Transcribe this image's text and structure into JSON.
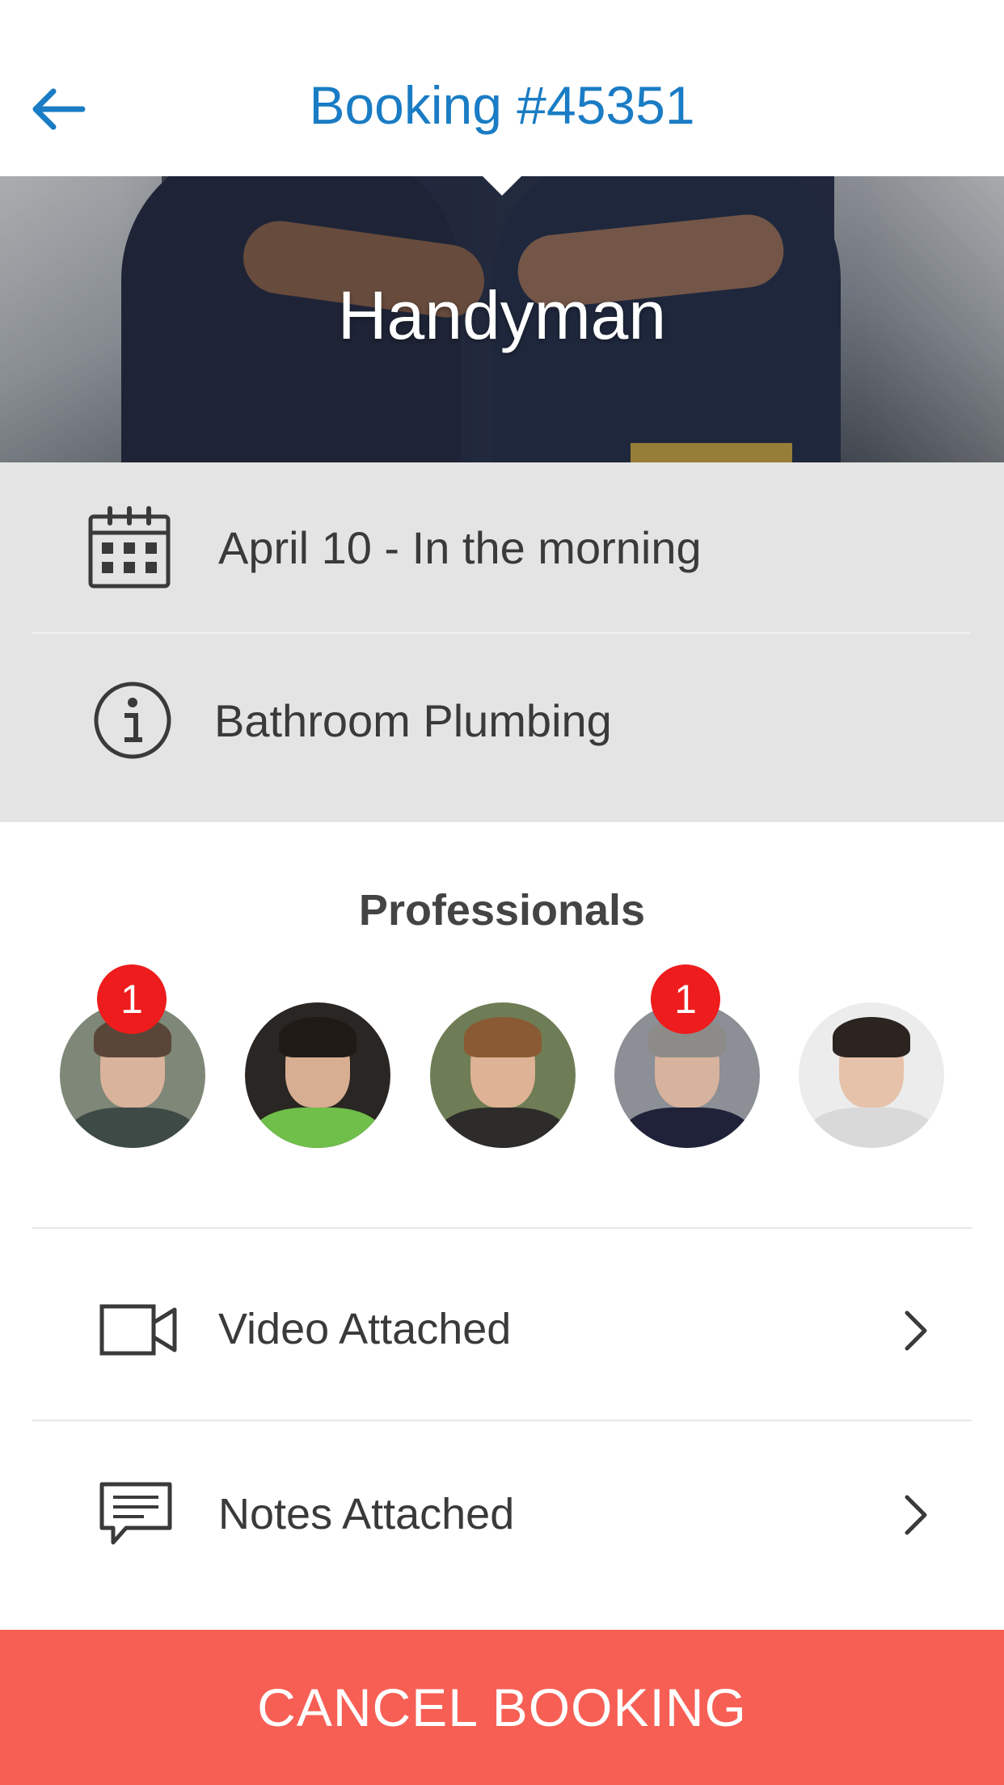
{
  "header": {
    "title": "Booking #45351",
    "back_icon": "back-arrow-icon",
    "accent_color": "#1a7cc4"
  },
  "hero": {
    "service": "Handyman"
  },
  "details": {
    "date": {
      "icon": "calendar-icon",
      "text": "April 10 - In the morning"
    },
    "description": {
      "icon": "info-icon",
      "text": "Bathroom Plumbing"
    }
  },
  "professionals": {
    "title": "Professionals",
    "items": [
      {
        "badge": "1"
      },
      {
        "badge": null
      },
      {
        "badge": null
      },
      {
        "badge": "1"
      },
      {
        "badge": null
      }
    ]
  },
  "attachments": [
    {
      "icon": "video-camera-icon",
      "label": "Video Attached",
      "chevron": "chevron-right-icon"
    },
    {
      "icon": "chat-bubble-icon",
      "label": "Notes Attached",
      "chevron": "chevron-right-icon"
    }
  ],
  "actions": {
    "cancel_label": "CANCEL BOOKING",
    "cancel_color": "#f75f55",
    "badge_color": "#ee1c1c"
  }
}
